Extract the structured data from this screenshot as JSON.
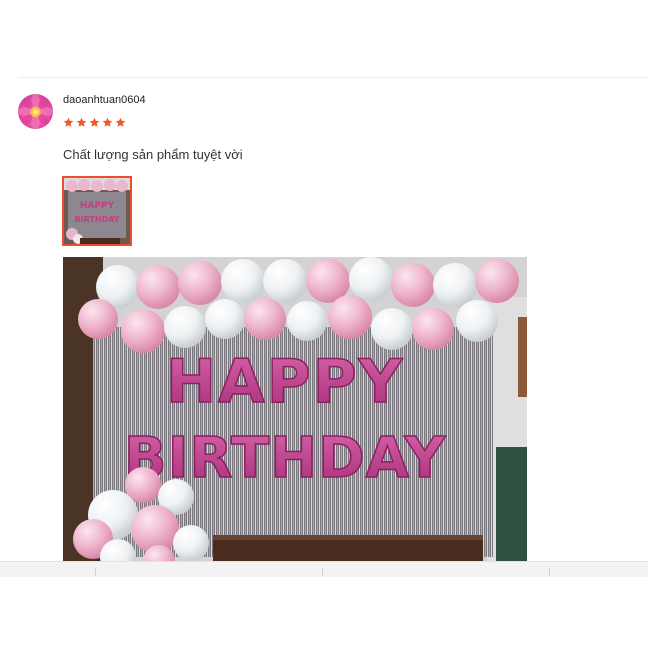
{
  "review": {
    "username": "daoanhtuan0604",
    "rating": 5,
    "rating_max": 5,
    "comment": "Chất lượng sản phẩm tuyệt vời",
    "photo_banner_line1": "HAPPY",
    "photo_banner_line2": "BIRTHDAY"
  },
  "colors": {
    "star": "#ee5a2c",
    "selected_thumb_border": "#ee4d2d"
  },
  "icons": {
    "avatar": "flower-avatar",
    "rating": "star-icon"
  }
}
